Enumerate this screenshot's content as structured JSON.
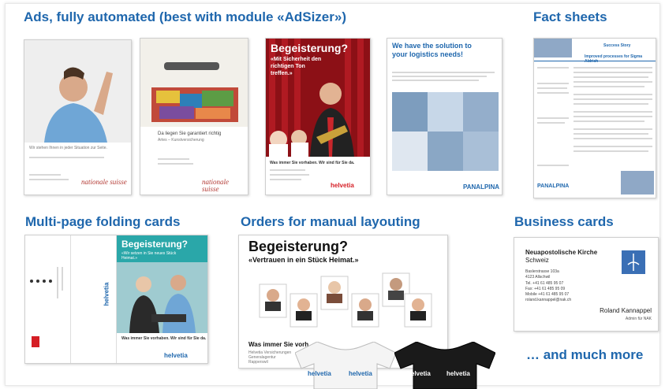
{
  "headings": {
    "ads": "Ads, fully automated (best with module «AdSizer»)",
    "fact_sheets": "Fact sheets",
    "folding_cards": "Multi-page folding cards",
    "manual_layouting": "Orders for manual layouting",
    "business_cards": "Business cards",
    "more": "… and much more"
  },
  "ad1": {
    "text": "Wir stehen Ihnen in jeder Situation zur Seite.",
    "brand": "nationale suisse"
  },
  "ad2": {
    "headline": "Da liegen Sie garantiert richtig",
    "sub": "Artes – Kunstversicherung",
    "brand": "nationale suisse"
  },
  "ad3": {
    "headline": "Begeisterung?",
    "sub": "«Mit Sicherheit den richtigen Ton treffen.»",
    "footer": "Was immer Sie vorhaben. Wir sind für Sie da.",
    "brand": "helvetia"
  },
  "ad4": {
    "headline": "We have the solution to your logistics needs!",
    "brand": "PANALPINA"
  },
  "factsheet": {
    "title": "Success Story",
    "subtitle": "Improved processes for Sigma Aldrich",
    "brand": "PANALPINA"
  },
  "folding": {
    "headline": "Begeisterung?",
    "sub": "«Wir setzen in Sie neues Stück Heimat.»",
    "footer": "Was immer Sie vorhaben. Wir sind für Sie da.",
    "brand": "helvetia"
  },
  "manual": {
    "headline": "Begeisterung?",
    "sub": "«Vertrauen in ein Stück Heimat.»",
    "footer": "Was immer Sie vorh",
    "address": "Helvetia Versicherungen Generalagentur Rapperswil",
    "shirt_brand": "helvetia"
  },
  "bizcard": {
    "org": "Neuapostolische Kirche",
    "country": "Schweiz",
    "street": "Baslerstrasse 103a",
    "city": "4123 Allschwil",
    "tel": "Tel.    +41 61 485 95 07",
    "fax": "Fax:   +41 61 485 95 09",
    "mobile": "Mobile +41 61 485 95 07",
    "email": "roland.kannappel@nak.ch",
    "name": "Roland Kannappel",
    "role": "Admin für NAK"
  }
}
